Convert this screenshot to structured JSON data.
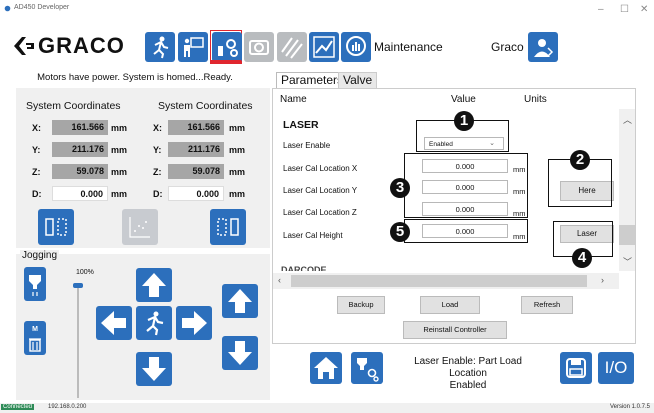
{
  "window": {
    "title": "AD450 Developer",
    "min": "–",
    "max": "☐",
    "close": "✕"
  },
  "header": {
    "logo_text": "GRACO",
    "screen_title": "Maintenance",
    "user": "Graco"
  },
  "status_top": "Motors have power. System is homed...Ready.",
  "coords": {
    "left_title": "System Coordinates",
    "right_title": "System Coordinates",
    "unit": "mm",
    "left": [
      {
        "axis": "X:",
        "value": "161.566"
      },
      {
        "axis": "Y:",
        "value": "211.176"
      },
      {
        "axis": "Z:",
        "value": "59.078"
      },
      {
        "axis": "D:",
        "value": "0.000"
      }
    ],
    "right": [
      {
        "axis": "X:",
        "value": "161.566"
      },
      {
        "axis": "Y:",
        "value": "211.176"
      },
      {
        "axis": "Z:",
        "value": "59.078"
      },
      {
        "axis": "D:",
        "value": "0.000"
      }
    ]
  },
  "jogging": {
    "label": "Jogging",
    "speed": "100%",
    "speed_fraction": 1.0
  },
  "tabs": {
    "parameters": "Parameters",
    "valve": "Valve"
  },
  "grid": {
    "col_name": "Name",
    "col_value": "Value",
    "col_units": "Units",
    "section": "LASER",
    "next_section": "DARCODE",
    "rows": [
      {
        "name": "Laser Enable",
        "value": "Enabled",
        "unit": ""
      },
      {
        "name": "Laser Cal Location X",
        "value": "0.000",
        "unit": "mm"
      },
      {
        "name": "Laser Cal Location Y",
        "value": "0.000",
        "unit": "mm"
      },
      {
        "name": "Laser Cal Location Z",
        "value": "0.000",
        "unit": "mm"
      },
      {
        "name": "Laser Cal Height",
        "value": "0.000",
        "unit": "mm"
      }
    ],
    "here_button": "Here",
    "laser_button": "Laser"
  },
  "callouts": [
    "1",
    "2",
    "3",
    "4",
    "5"
  ],
  "actions": {
    "backup": "Backup",
    "load": "Load",
    "refresh": "Refresh",
    "reinstall": "Reinstall Controller"
  },
  "bottom": {
    "status_line1": "Laser Enable: Part Load Location",
    "status_line2": "Enabled",
    "io_label": "I/O"
  },
  "statusbar": {
    "connection": "Connected",
    "ip": "192.168.0.200",
    "version": "Version 1.0.7.5"
  },
  "colors": {
    "accent_blue": "#2c6fbc",
    "active_tab_red": "#e0262e",
    "connected_green": "#2e8b57"
  }
}
